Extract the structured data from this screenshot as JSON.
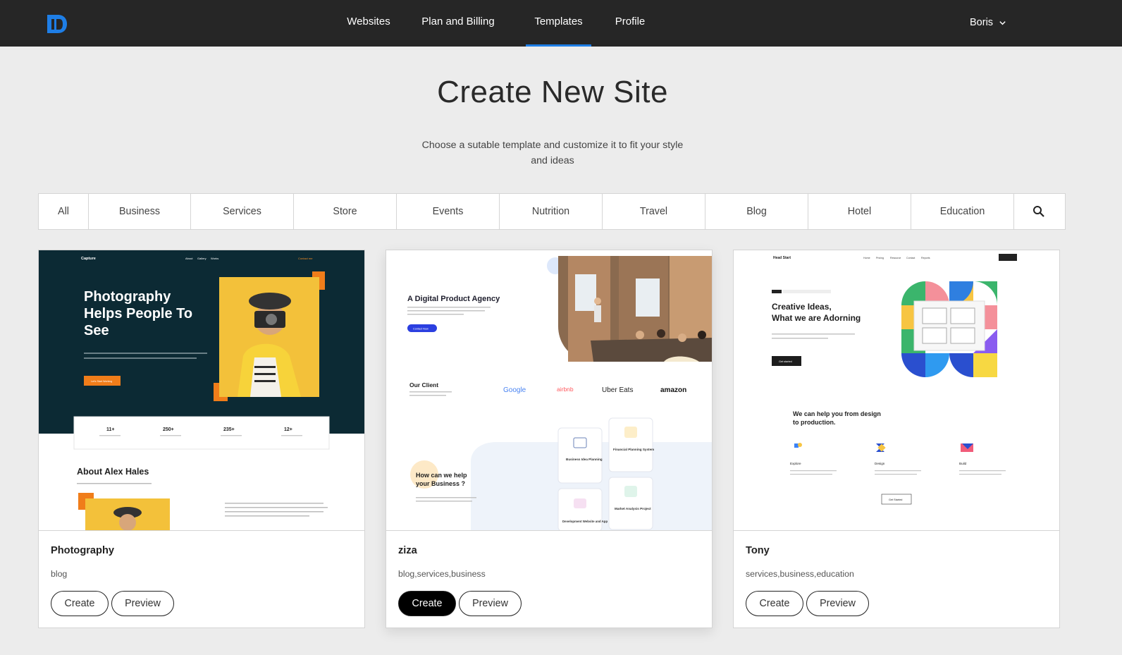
{
  "nav": {
    "items": [
      "Websites",
      "Plan and Billing",
      "Templates",
      "Profile"
    ],
    "active": "Templates",
    "user": "Boris"
  },
  "page": {
    "title": "Create New Site",
    "subtitle": "Choose a sutable template and customize it to fit your style and ideas"
  },
  "filters": [
    "All",
    "Business",
    "Services",
    "Store",
    "Events",
    "Nutrition",
    "Travel",
    "Blog",
    "Hotel",
    "Education"
  ],
  "colors": {
    "accent": "#1e7ee6",
    "topbar": "#262626",
    "background": "#ececec"
  },
  "templates": [
    {
      "name": "Photography",
      "tags": "blog",
      "create_label": "Create",
      "preview_label": "Preview",
      "thumb": {
        "brand": "Capture",
        "menu": [
          "About",
          "Gallery",
          "Works"
        ],
        "cta_top": "Contact me",
        "headline": [
          "Photography",
          "Helps People To",
          "See"
        ],
        "button": "Let's Start Working",
        "stats": [
          "11+",
          "250+",
          "235+",
          "12+"
        ],
        "about": "About Alex Hales"
      }
    },
    {
      "name": "ziza",
      "tags": "blog,services,business",
      "create_label": "Create",
      "preview_label": "Preview",
      "thumb": {
        "headline": "A Digital Product Agency",
        "button": "Contact Now",
        "clients_title": "Our Client",
        "logos": [
          "Google",
          "airbnb",
          "Uber Eats",
          "amazon"
        ],
        "help": [
          "How can we help",
          "your Business ?"
        ],
        "services": [
          "Business Idea Planning",
          "Financial Planning System",
          "Development Website and App",
          "Market Analysis Project"
        ]
      }
    },
    {
      "name": "Tony",
      "tags": "services,business,education",
      "create_label": "Create",
      "preview_label": "Preview",
      "thumb": {
        "brand": "Head Start",
        "menu": [
          "Home",
          "Pricing",
          "Resource",
          "Contact",
          "Reports"
        ],
        "headline": [
          "Creative Ideas,",
          "What we are Adorning"
        ],
        "button": "Get started",
        "section": [
          "We can help you from design",
          "to production."
        ],
        "features": [
          "Explore",
          "Design",
          "Build"
        ],
        "cta": "Get Started"
      }
    }
  ]
}
